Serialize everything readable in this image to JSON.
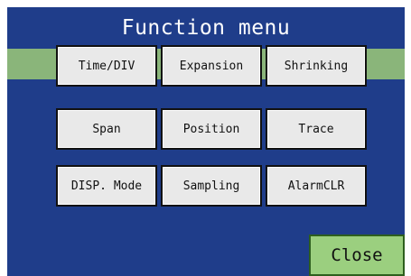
{
  "header": {
    "title": "Function menu"
  },
  "buttons": [
    {
      "label": "Time/DIV"
    },
    {
      "label": "Expansion"
    },
    {
      "label": "Shrinking"
    },
    {
      "label": "Span"
    },
    {
      "label": "Position"
    },
    {
      "label": "Trace"
    },
    {
      "label": "DISP. Mode"
    },
    {
      "label": "Sampling"
    },
    {
      "label": "AlarmCLR"
    }
  ],
  "footer": {
    "close_label": "Close"
  },
  "colors": {
    "panel_background": "#1f3d8a",
    "band": "#8ab57a",
    "button_face": "#e9e9e9",
    "close_button": "#9bcf7f",
    "title_text": "#ffffff"
  }
}
